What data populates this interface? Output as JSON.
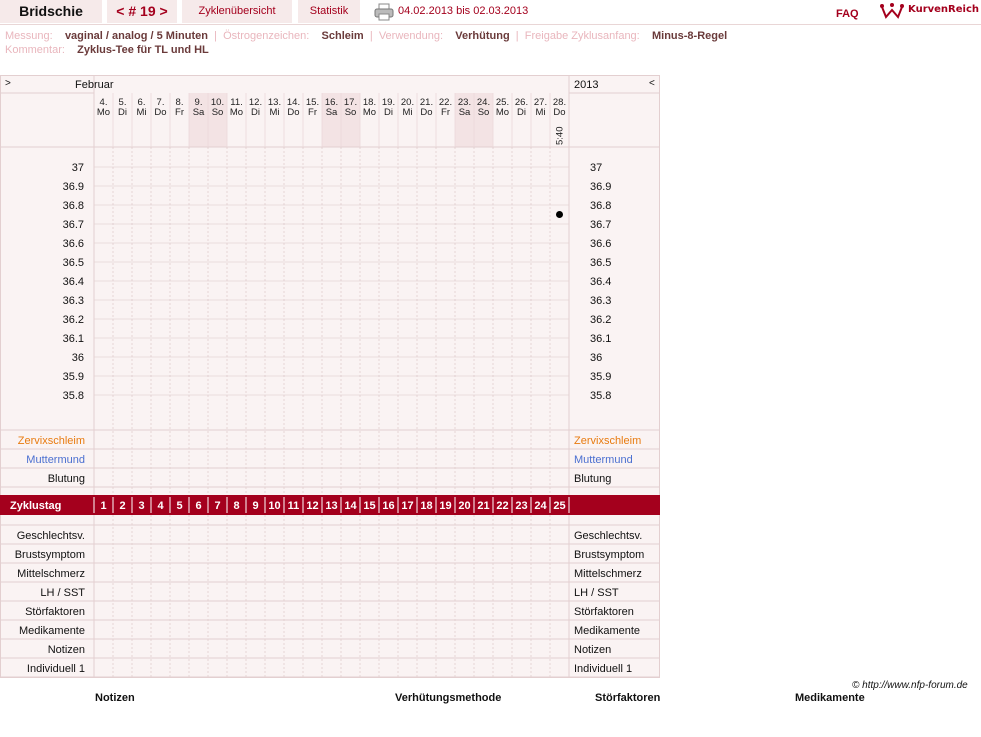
{
  "header": {
    "user_tab": "Bridschie",
    "cycle_tab": "< # 19 >",
    "overview_tab": "Zyklenübersicht",
    "stats_tab": "Statistik",
    "date_range": "04.02.2013 bis 02.03.2013",
    "faq": "FAQ",
    "brand": "KurvenReich"
  },
  "meta": {
    "measure_label": "Messung:",
    "measure_value": "vaginal / analog / 5 Minuten",
    "estrogen_label": "Östrogenzeichen:",
    "estrogen_value": "Schleim",
    "usage_label": "Verwendung:",
    "usage_value": "Verhütung",
    "release_label": "Freigabe Zyklusanfang:",
    "release_value": "Minus-8-Regel",
    "comment_label": "Kommentar:",
    "comment_value": "Zyklus-Tee für TL und HL"
  },
  "calendar": {
    "prev_arrow": ">",
    "next_arrow": "<",
    "month": "Februar",
    "year": "2013",
    "days": [
      {
        "date": "4.",
        "weekday": "Mo",
        "weekend": false
      },
      {
        "date": "5.",
        "weekday": "Di",
        "weekend": false
      },
      {
        "date": "6.",
        "weekday": "Mi",
        "weekend": false
      },
      {
        "date": "7.",
        "weekday": "Do",
        "weekend": false
      },
      {
        "date": "8.",
        "weekday": "Fr",
        "weekend": false
      },
      {
        "date": "9.",
        "weekday": "Sa",
        "weekend": true
      },
      {
        "date": "10.",
        "weekday": "So",
        "weekend": true
      },
      {
        "date": "11.",
        "weekday": "Mo",
        "weekend": false
      },
      {
        "date": "12.",
        "weekday": "Di",
        "weekend": false
      },
      {
        "date": "13.",
        "weekday": "Mi",
        "weekend": false
      },
      {
        "date": "14.",
        "weekday": "Do",
        "weekend": false
      },
      {
        "date": "15.",
        "weekday": "Fr",
        "weekend": false
      },
      {
        "date": "16.",
        "weekday": "Sa",
        "weekend": true
      },
      {
        "date": "17.",
        "weekday": "So",
        "weekend": true
      },
      {
        "date": "18.",
        "weekday": "Mo",
        "weekend": false
      },
      {
        "date": "19.",
        "weekday": "Di",
        "weekend": false
      },
      {
        "date": "20.",
        "weekday": "Mi",
        "weekend": false
      },
      {
        "date": "21.",
        "weekday": "Do",
        "weekend": false
      },
      {
        "date": "22.",
        "weekday": "Fr",
        "weekend": false
      },
      {
        "date": "23.",
        "weekday": "Sa",
        "weekend": true
      },
      {
        "date": "24.",
        "weekday": "So",
        "weekend": true
      },
      {
        "date": "25.",
        "weekday": "Mo",
        "weekend": false
      },
      {
        "date": "26.",
        "weekday": "Di",
        "weekend": false
      },
      {
        "date": "27.",
        "weekday": "Mi",
        "weekend": false
      },
      {
        "date": "28.",
        "weekday": "Do",
        "weekend": false
      }
    ],
    "measure_time_last": "5:40"
  },
  "chart_data": {
    "type": "scatter",
    "y_ticks": [
      "37",
      "36.9",
      "36.8",
      "36.7",
      "36.6",
      "36.5",
      "36.4",
      "36.3",
      "36.2",
      "36.1",
      "36",
      "35.9",
      "35.8"
    ],
    "ylim": [
      35.8,
      37
    ],
    "points": [
      {
        "day": 25,
        "temp": 36.75
      }
    ]
  },
  "rows_mid": [
    {
      "label": "Zervixschleim",
      "color": "#e87b10"
    },
    {
      "label": "Muttermund",
      "color": "#4a6fd0"
    },
    {
      "label": "Blutung",
      "color": "#111111"
    }
  ],
  "cycle_row": {
    "label": "Zyklustag",
    "days": [
      "1",
      "2",
      "3",
      "4",
      "5",
      "6",
      "7",
      "8",
      "9",
      "10",
      "11",
      "12",
      "13",
      "14",
      "15",
      "16",
      "17",
      "18",
      "19",
      "20",
      "21",
      "22",
      "23",
      "24",
      "25"
    ]
  },
  "rows_bottom": [
    "Geschlechtsv.",
    "Brustsymptom",
    "Mittelschmerz",
    "LH / SST",
    "Störfaktoren",
    "Medikamente",
    "Notizen",
    "Individuell 1"
  ],
  "footer": {
    "copyright": "© http://www.nfp-forum.de",
    "notes": "Notizen",
    "method": "Verhütungsmethode",
    "disturb": "Störfaktoren",
    "meds": "Medikamente"
  },
  "colors": {
    "accent": "#a4001d",
    "label_pink": "#e9b6bd",
    "grid_bg": "#faf3f3",
    "weekend_bg": "#f3e3e4"
  }
}
